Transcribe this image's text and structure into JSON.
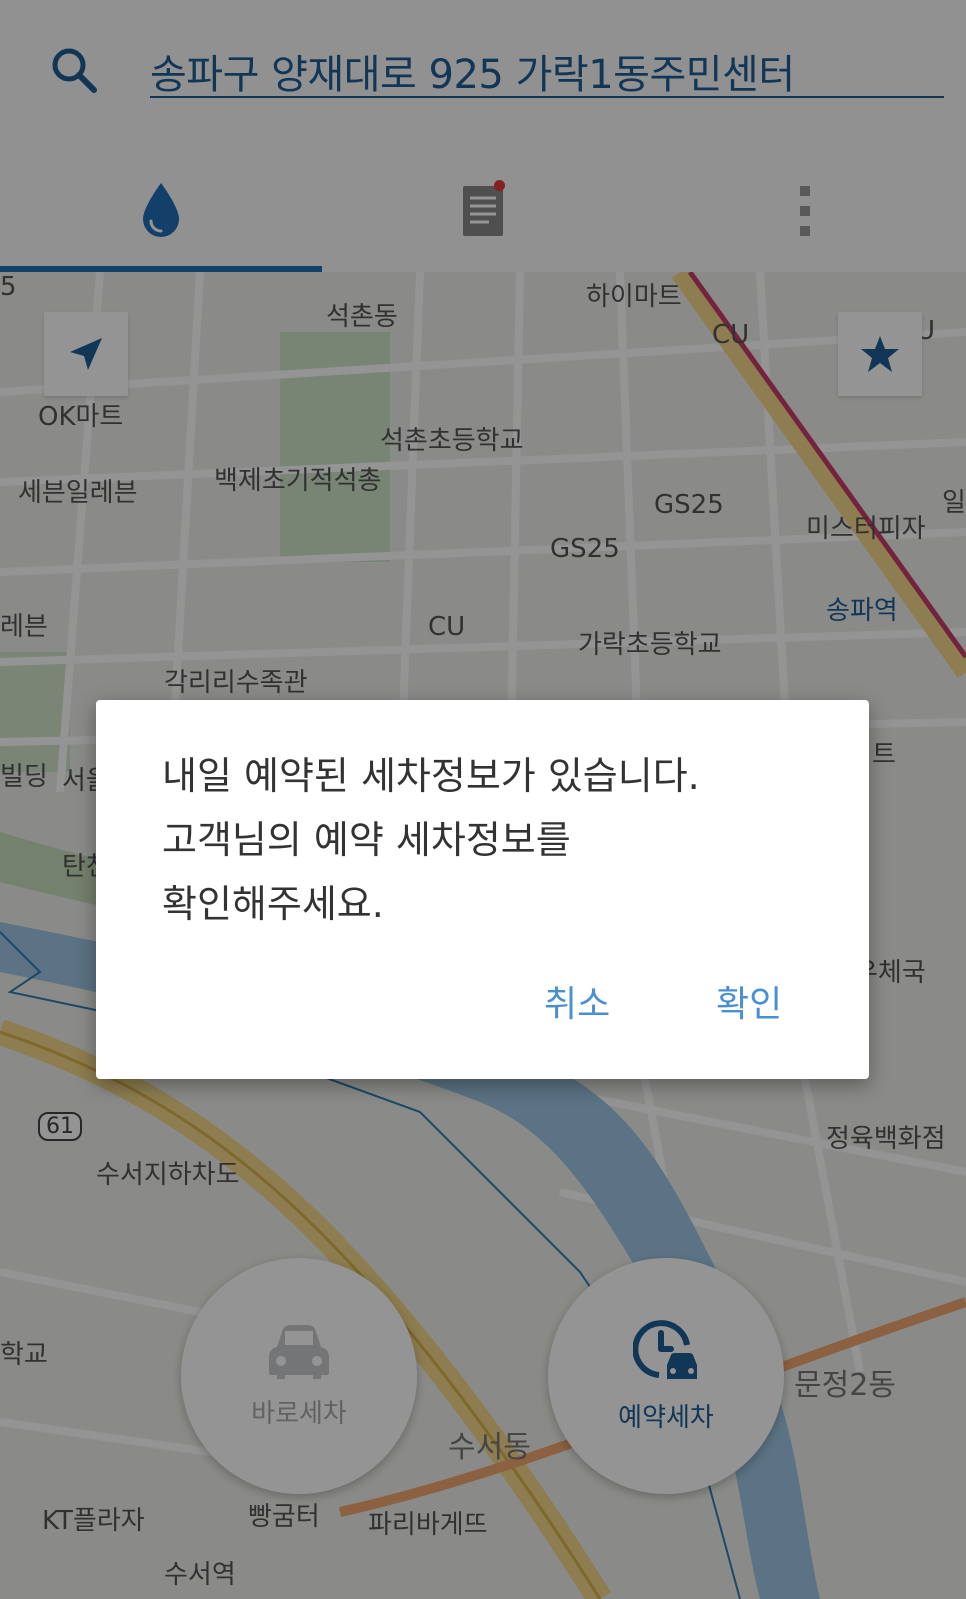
{
  "search": {
    "query": "송파구 양재대로 925 가락1동주민센터"
  },
  "tabs": [
    {
      "icon": "water-drop-icon"
    },
    {
      "icon": "document-list-icon",
      "has_notification": true
    },
    {
      "icon": "more-vertical-icon"
    }
  ],
  "map": {
    "labels": [
      {
        "text": "5"
      },
      {
        "text": "석촌동"
      },
      {
        "text": "하이마트"
      },
      {
        "text": "CU"
      },
      {
        "text": "U"
      },
      {
        "text": "OK마트"
      },
      {
        "text": "석촌초등학교"
      },
      {
        "text": "세븐일레븐"
      },
      {
        "text": "백제초기적석총"
      },
      {
        "text": "GS25"
      },
      {
        "text": "미스터피자"
      },
      {
        "text": "일"
      },
      {
        "text": "GS25"
      },
      {
        "text": "송파역"
      },
      {
        "text": "레븐"
      },
      {
        "text": "CU"
      },
      {
        "text": "가락초등학교"
      },
      {
        "text": "각리리수족관"
      },
      {
        "text": "빌딩"
      },
      {
        "text": "서울"
      },
      {
        "text": "트"
      },
      {
        "text": "탄천"
      },
      {
        "text": "우체국"
      },
      {
        "text": "61"
      },
      {
        "text": "정육백화점"
      },
      {
        "text": "수서지하차도"
      },
      {
        "text": "학교"
      },
      {
        "text": "문정2동"
      },
      {
        "text": "수서동"
      },
      {
        "text": "KT플라자"
      },
      {
        "text": "빵굼터"
      },
      {
        "text": "파리바게뜨"
      },
      {
        "text": "수서역"
      }
    ],
    "fab_instant": {
      "label": "바로세차",
      "icon": "car-icon"
    },
    "fab_reserve": {
      "label": "예약세차",
      "icon": "clock-car-icon"
    }
  },
  "dialog": {
    "lines": [
      "내일 예약된 세차정보가 있습니다.",
      "고객님의 예약 세차정보를",
      "확인해주세요."
    ],
    "cancel_label": "취소",
    "confirm_label": "확인"
  },
  "colors": {
    "brand": "#1f5f95",
    "accent": "#4a8fd2",
    "notice": "#e53935"
  }
}
